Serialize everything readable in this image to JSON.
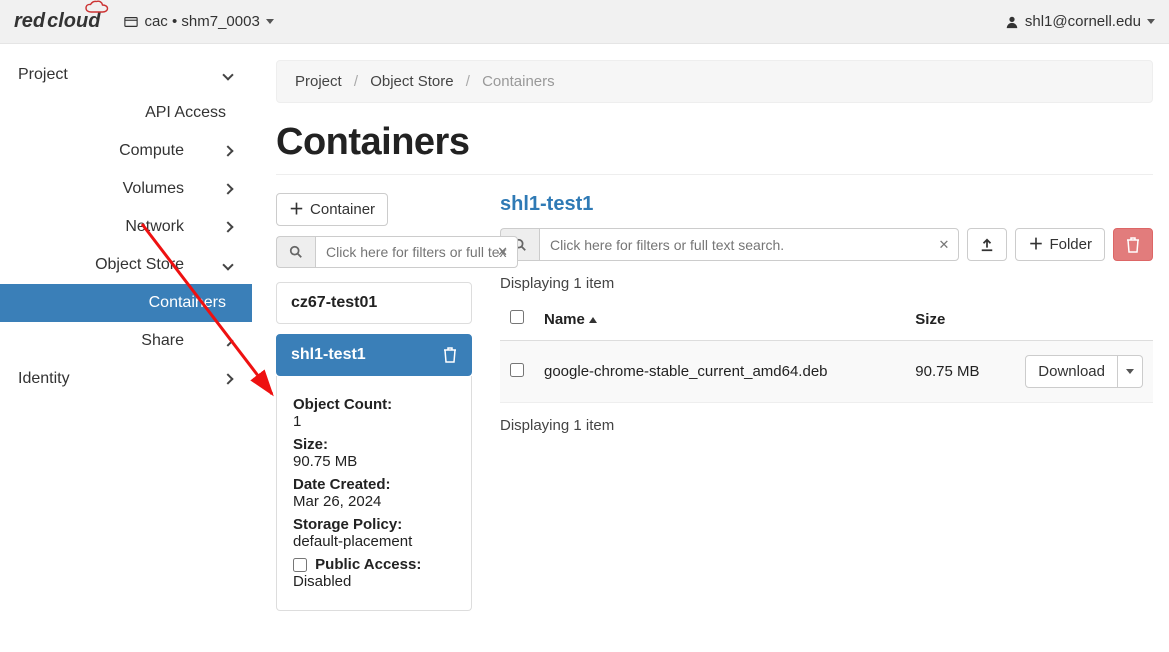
{
  "topbar": {
    "brand_red": "red",
    "brand_cloud": "cloud",
    "project_switcher": "cac • shm7_0003",
    "user": "shl1@cornell.edu"
  },
  "sidebar": {
    "project": "Project",
    "api_access": "API Access",
    "compute": "Compute",
    "volumes": "Volumes",
    "network": "Network",
    "object_store": "Object Store",
    "containers": "Containers",
    "share": "Share",
    "identity": "Identity"
  },
  "breadcrumb": {
    "a": "Project",
    "b": "Object Store",
    "c": "Containers"
  },
  "page_title": "Containers",
  "left": {
    "new_container_btn": "Container",
    "filter_placeholder": "Click here for filters or full text search.",
    "containers": [
      {
        "name": "cz67-test01"
      },
      {
        "name": "shl1-test1"
      }
    ],
    "details": {
      "object_count_label": "Object Count:",
      "object_count": "1",
      "size_label": "Size:",
      "size": "90.75 MB",
      "date_created_label": "Date Created:",
      "date_created": "Mar 26, 2024",
      "storage_policy_label": "Storage Policy:",
      "storage_policy": "default-placement",
      "public_access_label": "Public Access:",
      "public_access": "Disabled"
    }
  },
  "right": {
    "title": "shl1-test1",
    "filter_placeholder": "Click here for filters or full text search.",
    "folder_btn": "Folder",
    "displaying": "Displaying 1 item",
    "columns": {
      "name": "Name",
      "size": "Size"
    },
    "rows": [
      {
        "name": "google-chrome-stable_current_amd64.deb",
        "size": "90.75 MB",
        "action": "Download"
      }
    ]
  }
}
